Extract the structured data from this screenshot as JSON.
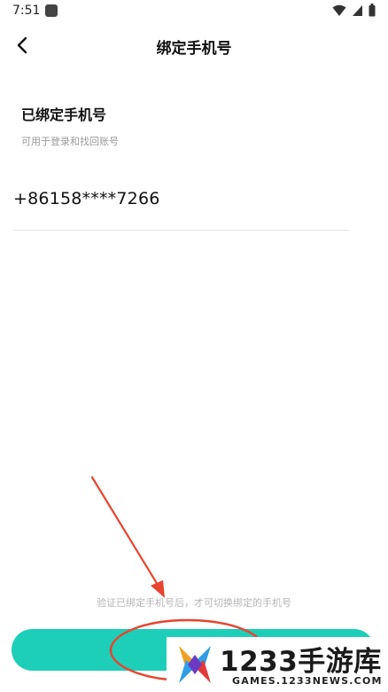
{
  "status_bar": {
    "time": "7:51",
    "icons": [
      "app-notification-icon",
      "wifi-icon",
      "signal-icon",
      "battery-icon"
    ]
  },
  "header": {
    "title": "绑定手机号",
    "back_icon": "chevron-left-icon"
  },
  "bound_phone": {
    "title": "已绑定手机号",
    "description": "可用于登录和找回账号",
    "number": "+86158****7266"
  },
  "footer": {
    "hint": "验证已绑定手机号后，才可切换绑定的手机号",
    "button_label": ""
  },
  "watermark": {
    "brand": "1233手游库",
    "site": "GAMES.1233NEWS.COM"
  },
  "colors": {
    "accent": "#1dcfb8",
    "annotation": "#e8442f",
    "hint": "#b5b5b5"
  }
}
